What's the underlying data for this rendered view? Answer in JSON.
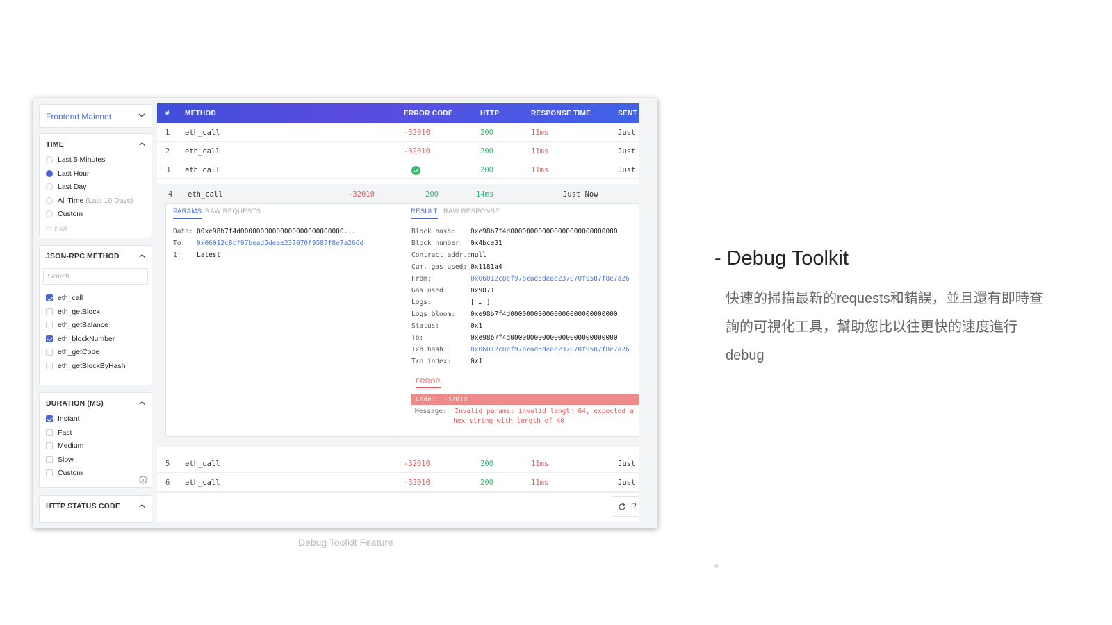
{
  "network": {
    "selected": "Frontend Mainnet"
  },
  "filters": {
    "time": {
      "title": "TIME",
      "options": [
        {
          "label": "Last 5 Minutes",
          "selected": false
        },
        {
          "label": "Last Hour",
          "selected": true
        },
        {
          "label": "Last Day",
          "selected": false
        },
        {
          "label": "All Time",
          "hint": "(Last 10 Days)",
          "selected": false
        },
        {
          "label": "Custom",
          "selected": false
        }
      ],
      "clear_label": "CLEAR"
    },
    "method": {
      "title": "JSON-RPC METHOD",
      "search_placeholder": "Search",
      "options": [
        {
          "label": "eth_call",
          "checked": true
        },
        {
          "label": "eth_getBlock",
          "checked": false
        },
        {
          "label": "eth_getBalance",
          "checked": false
        },
        {
          "label": "eth_blockNumber",
          "checked": true
        },
        {
          "label": "eth_getCode",
          "checked": false
        },
        {
          "label": "eth_getBlockByHash",
          "checked": false
        }
      ]
    },
    "duration": {
      "title": "DURATION (MS)",
      "options": [
        {
          "label": "Instant",
          "checked": true
        },
        {
          "label": "Fast",
          "checked": false
        },
        {
          "label": "Medium",
          "checked": false
        },
        {
          "label": "Slow",
          "checked": false
        },
        {
          "label": "Custom",
          "checked": false
        }
      ]
    },
    "http_status": {
      "title": "HTTP STATUS CODE"
    }
  },
  "table": {
    "headers": {
      "num": "#",
      "method": "METHOD",
      "error_code": "ERROR CODE",
      "http": "HTTP",
      "response_time": "RESPONSE TIME",
      "sent": "SENT"
    },
    "rows": [
      {
        "num": "1",
        "method": "eth_call",
        "error_code": "-32010",
        "http": "200",
        "response_time": "11ms",
        "sent": "Just"
      },
      {
        "num": "2",
        "method": "eth_call",
        "error_code": "-32010",
        "http": "200",
        "response_time": "11ms",
        "sent": "Just"
      },
      {
        "num": "3",
        "method": "eth_call",
        "error_code": "",
        "success": true,
        "http": "200",
        "response_time": "11ms",
        "sent": "Just"
      },
      {
        "num": "5",
        "method": "eth_call",
        "error_code": "-32010",
        "http": "200",
        "response_time": "11ms",
        "sent": "Just"
      },
      {
        "num": "6",
        "method": "eth_call",
        "error_code": "-32010",
        "http": "200",
        "response_time": "11ms",
        "sent": "Just"
      }
    ],
    "expanded": {
      "num": "4",
      "method": "eth_call",
      "error_code": "-32010",
      "http": "200",
      "response_time": "14ms",
      "sent": "Just Now",
      "params_tabs": [
        "PARAMS",
        "RAW REQUESTS"
      ],
      "params": [
        {
          "key": "Data:",
          "value": "00xe98b7f4d00000000000000000000000000...",
          "link": false
        },
        {
          "key": "To:",
          "value": "0x06012c8cf97bead5deae237070f9587f8e7a266d",
          "link": true
        },
        {
          "key": "1:",
          "value": "Latest",
          "link": false
        }
      ],
      "result_tabs": [
        "RESULT",
        "RAW RESPONSE"
      ],
      "result": [
        {
          "key": "Block hash:",
          "value": "0xe98b7f4d000000000000000000000000000",
          "link": false
        },
        {
          "key": "Block number:",
          "value": "0x4bce31",
          "link": false
        },
        {
          "key": "Contract addr.:",
          "value": "null",
          "link": false
        },
        {
          "key": "Cum. gas used:",
          "value": "0x1181a4",
          "link": false
        },
        {
          "key": "From:",
          "value": "0x06012c8cf97bead5deae237070f9587f8e7a26",
          "link": true
        },
        {
          "key": "Gas used:",
          "value": "0x9071",
          "link": false
        },
        {
          "key": "Logs:",
          "value": "[ … ]",
          "link": false
        },
        {
          "key": "Logs bloom:",
          "value": "0xe98b7f4d000000000000000000000000000",
          "link": false
        },
        {
          "key": "Status:",
          "value": "0x1",
          "link": false
        },
        {
          "key": "To:",
          "value": "0xe98b7f4d000000000000000000000000000",
          "link": false
        },
        {
          "key": "Txn hash:",
          "value": "0x06012c8cf97bead5deae237070f9587f8e7a26",
          "link": true
        },
        {
          "key": "Txn index:",
          "value": "0x1",
          "link": false
        }
      ],
      "error": {
        "tab": "ERROR",
        "code_label": "Code:",
        "code": "-32010",
        "message_label": "Message:",
        "message_line1": "Invalid params: invalid length 64, expected a",
        "message_line2": "hex string with length of 40"
      }
    },
    "refresh_label": "R"
  },
  "caption": "Debug Toolkit Feature",
  "slide": {
    "title": "- Debug Toolkit",
    "description": "快速的掃描最新的requests和錯誤，並且還有即時查詢的可視化工具，幫助您比以往更快的速度進行debug"
  },
  "colors": {
    "accent": "#4c6ad6",
    "header_start": "#3f4fd9",
    "header_end": "#3f62e8",
    "error": "#e55d5d",
    "success": "#3db67a"
  }
}
